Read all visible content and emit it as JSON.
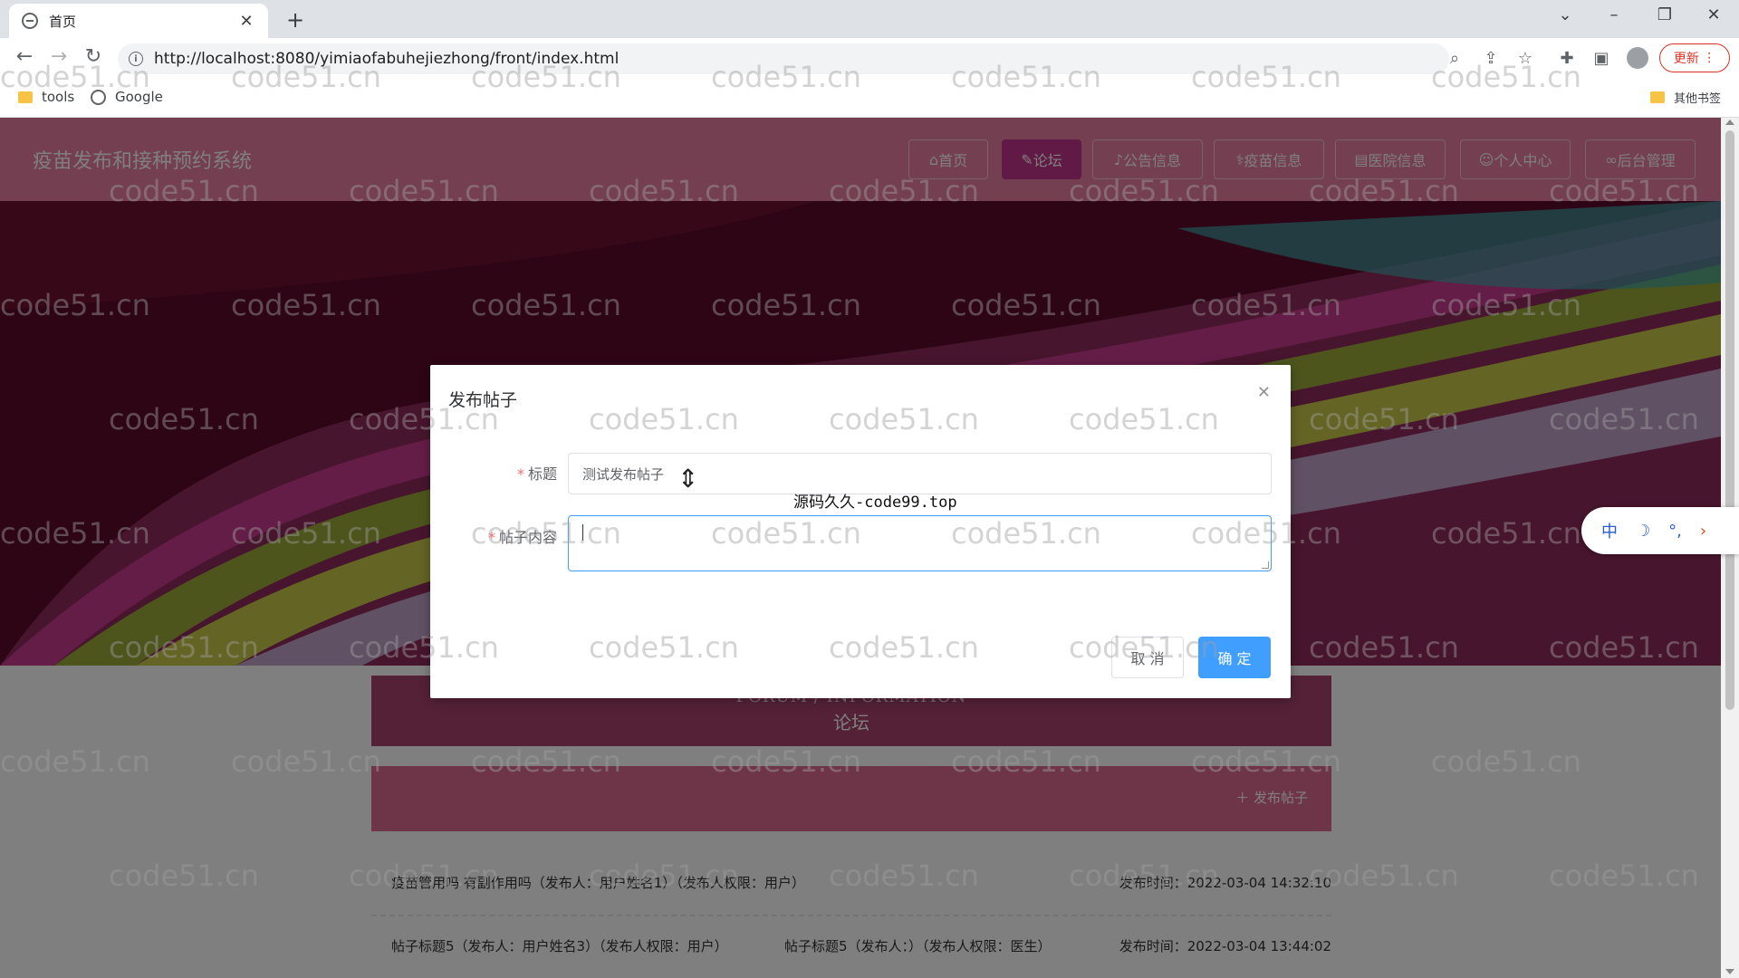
{
  "browser": {
    "tab_title": "首页",
    "tab_close": "✕",
    "new_tab": "+",
    "url": "http://localhost:8080/yimiaofabuhejiezhong/front/index.html",
    "update_label": "更新",
    "bookmarks": [
      "tools",
      "Google"
    ],
    "other_bookmarks": "其他书签"
  },
  "site": {
    "title": "疫苗发布和接种预约系统",
    "nav": [
      {
        "label": "首页",
        "icon": "home-icon"
      },
      {
        "label": "论坛",
        "icon": "edit-icon"
      },
      {
        "label": "公告信息",
        "icon": "bell-icon"
      },
      {
        "label": "疫苗信息",
        "icon": "vaccine-icon"
      },
      {
        "label": "医院信息",
        "icon": "hospital-icon"
      },
      {
        "label": "个人中心",
        "icon": "user-icon"
      },
      {
        "label": "后台管理",
        "icon": "link-icon"
      }
    ],
    "active_nav": 1
  },
  "forum": {
    "heading_en": "FORUM / INFORMATION",
    "heading_cn": "论坛",
    "publish_label": "发布帖子",
    "posts": [
      {
        "left": "疫苗管用吗 有副作用吗（发布人：用户姓名1）（发布人权限：用户）",
        "mid": "",
        "time": "发布时间：2022-03-04 14:32:10"
      },
      {
        "left": "帖子标题5（发布人：用户姓名3）（发布人权限：用户）",
        "mid": "帖子标题5（发布人：）（发布人权限：医生）",
        "time": "发布时间：2022-03-04 13:44:02"
      }
    ]
  },
  "dialog": {
    "title": "发布帖子",
    "title_label": "标题",
    "title_value": "测试发布帖子",
    "content_label": "帖子内容",
    "content_value": "",
    "cancel_label": "取 消",
    "ok_label": "确 定"
  },
  "overlay_text": "源码久久-code99.top",
  "ime": {
    "lang": "中",
    "moon": "☽",
    "punct": "°,",
    "arrow": "›"
  },
  "watermark": "code51.cn",
  "colors": {
    "header": "#e87ea2",
    "active_nav": "#c1358a",
    "primary": "#409eff"
  }
}
